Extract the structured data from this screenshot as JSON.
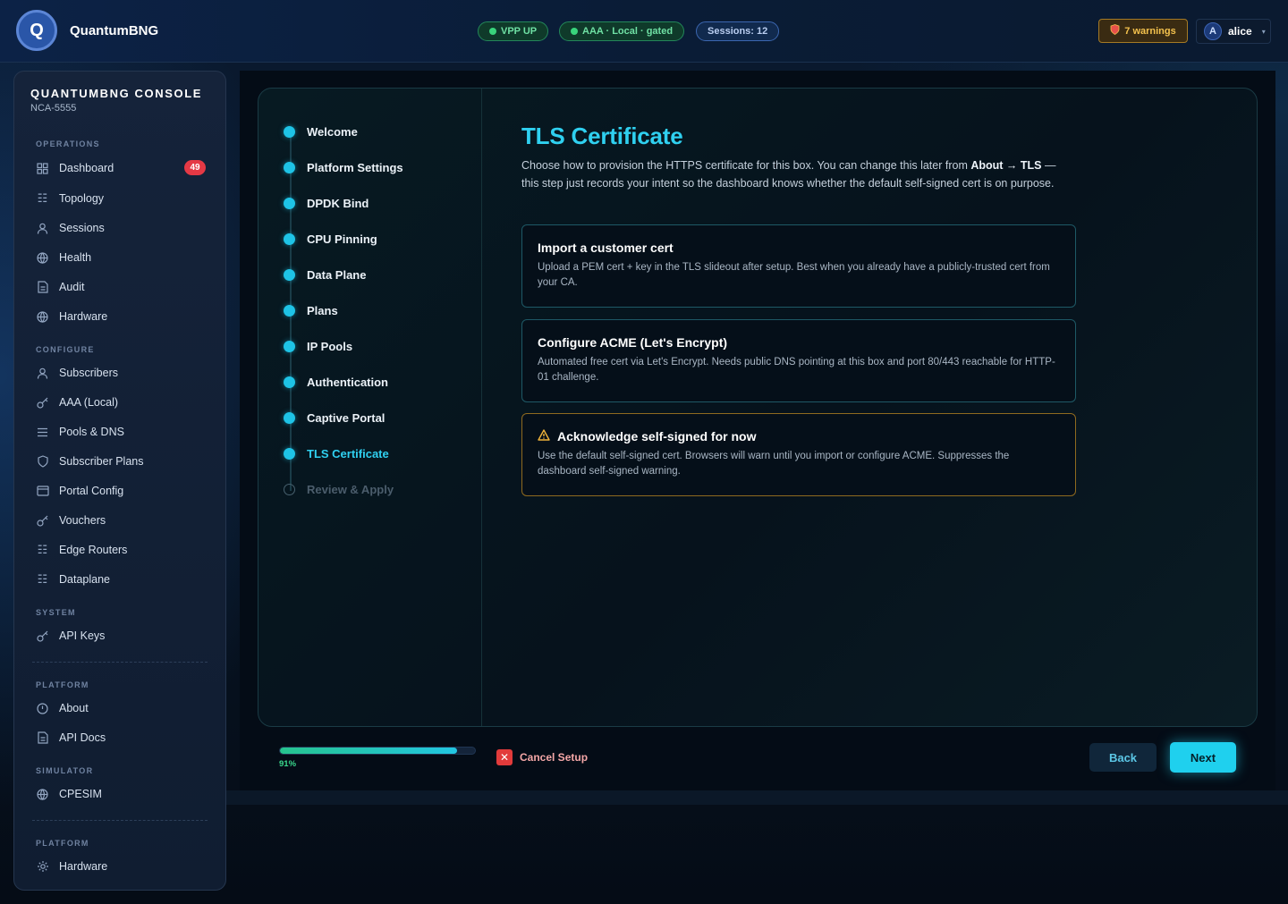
{
  "app": {
    "logo_letter": "Q",
    "name": "QuantumBNG"
  },
  "status": {
    "vpp": "VPP UP",
    "aaa": "AAA · Local · gated",
    "sessions": "Sessions: 12",
    "warnings": "7 warnings",
    "user_initial": "A",
    "user_name": "alice"
  },
  "sidebar": {
    "title": "QUANTUMBNG CONSOLE",
    "subtitle": "NCA-5555",
    "sections": {
      "operations": "OPERATIONS",
      "configure": "CONFIGURE",
      "system": "SYSTEM",
      "platform": "PLATFORM",
      "simulator": "SIMULATOR",
      "platform2": "PLATFORM"
    },
    "items": {
      "dashboard": "Dashboard",
      "dashboard_badge": "49",
      "topology": "Topology",
      "sessions": "Sessions",
      "health": "Health",
      "audit": "Audit",
      "hardware": "Hardware",
      "subscribers": "Subscribers",
      "aaa_local": "AAA (Local)",
      "pools_dns": "Pools & DNS",
      "subscriber_plans": "Subscriber Plans",
      "portal_config": "Portal Config",
      "vouchers": "Vouchers",
      "edge_routers": "Edge Routers",
      "dataplane": "Dataplane",
      "api_keys": "API Keys",
      "about": "About",
      "api_docs": "API Docs",
      "cpesim": "CPESIM",
      "hardware2": "Hardware"
    }
  },
  "wizard": {
    "steps": [
      "Welcome",
      "Platform Settings",
      "DPDK Bind",
      "CPU Pinning",
      "Data Plane",
      "Plans",
      "IP Pools",
      "Authentication",
      "Captive Portal",
      "TLS Certificate",
      "Review & Apply"
    ],
    "active_step": "TLS Certificate",
    "title": "TLS Certificate",
    "desc_part1": "Choose how to provision the HTTPS certificate for this box. You can change this later from ",
    "desc_bold": "About → TLS",
    "desc_part2": " — this step just records your intent so the dashboard knows whether the default self-signed cert is on purpose.",
    "options": [
      {
        "title": "Import a customer cert",
        "body": "Upload a PEM cert + key in the TLS slideout after setup. Best when you already have a publicly-trusted cert from your CA."
      },
      {
        "title": "Configure ACME (Let's Encrypt)",
        "body": "Automated free cert via Let's Encrypt. Needs public DNS pointing at this box and port 80/443 reachable for HTTP-01 challenge."
      },
      {
        "title": "Acknowledge self-signed for now",
        "body": "Use the default self-signed cert. Browsers will warn until you import or configure ACME. Suppresses the dashboard self-signed warning."
      }
    ],
    "progress_percent": 91,
    "progress_label": "91%",
    "cancel_label": "Cancel Setup",
    "back_label": "Back",
    "next_label": "Next"
  },
  "colors": {
    "accent": "#1fd0ee",
    "ok": "#39d47c",
    "warn": "#f0b43a",
    "danger": "#e23b3b"
  }
}
